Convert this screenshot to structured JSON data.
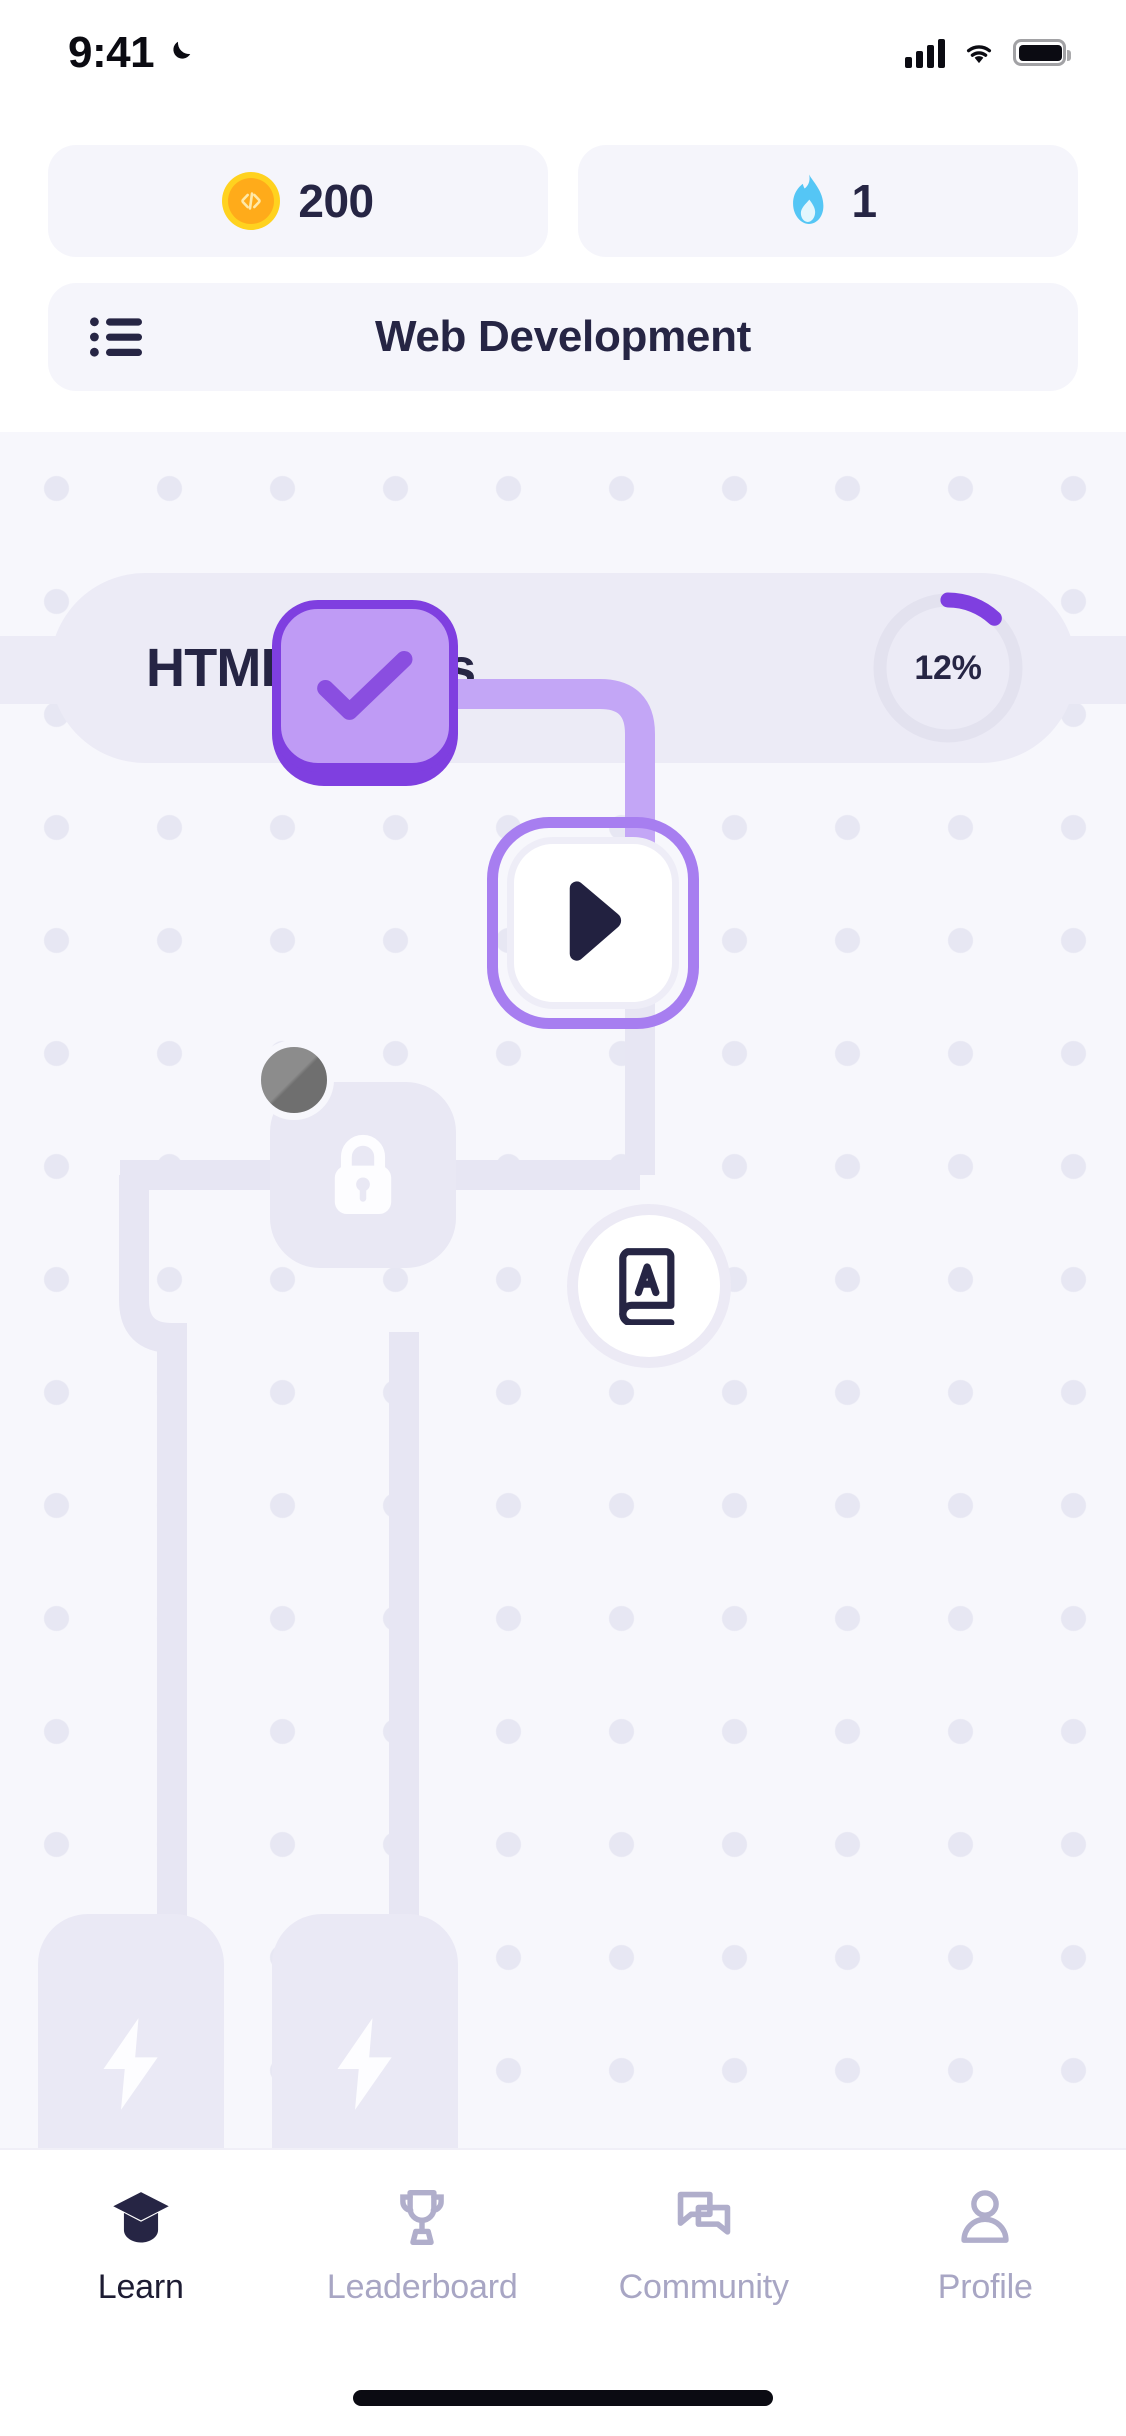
{
  "status_bar": {
    "time": "9:41",
    "moon_icon": "crescent-moon-icon",
    "cellular_icon": "cellular-signal-icon",
    "wifi_icon": "wifi-icon",
    "battery_icon": "battery-full-icon"
  },
  "header": {
    "stats": [
      {
        "icon": "code-coin-icon",
        "value": "200",
        "name": "xp-coins"
      },
      {
        "icon": "flame-icon",
        "value": "1",
        "name": "streak-days"
      }
    ],
    "course_selector": {
      "menu_icon": "list-menu-icon",
      "title": "Web Development"
    }
  },
  "unit": {
    "title": "HTML Basics",
    "progress_percent": "12%",
    "progress_value": 12,
    "ring_track_color": "#e3e2ef",
    "ring_fill_color": "#7f3fe0"
  },
  "path": {
    "nodes": [
      {
        "name": "lesson-node-completed",
        "state": "completed",
        "icon": "check-icon"
      },
      {
        "name": "lesson-node-current",
        "state": "current",
        "icon": "play-icon"
      },
      {
        "name": "lesson-node-locked-1",
        "state": "locked",
        "icon": "lock-icon"
      },
      {
        "name": "lesson-node-locked-2",
        "state": "locked",
        "icon": "lightning-bolt-icon"
      },
      {
        "name": "lesson-node-locked-3",
        "state": "locked",
        "icon": "lightning-bolt-icon"
      }
    ],
    "avatar": {
      "name": "user-avatar-marker",
      "icon": "avatar-icon"
    },
    "fab": {
      "name": "glossary-button",
      "icon": "book-a-icon"
    },
    "colors": {
      "completed_shell": "#7f3fe0",
      "completed_face": "#bf9bf5",
      "current_ring": "#a77ef0",
      "locked_fill": "#e9e8f4",
      "connector_active": "#c3a6f6",
      "connector_locked": "#e7e6f3"
    }
  },
  "tabbar": {
    "items": [
      {
        "label": "Learn",
        "icon": "graduation-cap-icon",
        "active": true,
        "name": "tab-learn"
      },
      {
        "label": "Leaderboard",
        "icon": "trophy-icon",
        "active": false,
        "name": "tab-leaderboard"
      },
      {
        "label": "Community",
        "icon": "chat-bubbles-icon",
        "active": false,
        "name": "tab-community"
      },
      {
        "label": "Profile",
        "icon": "person-icon",
        "active": false,
        "name": "tab-profile"
      }
    ],
    "home_indicator": "home-indicator"
  }
}
